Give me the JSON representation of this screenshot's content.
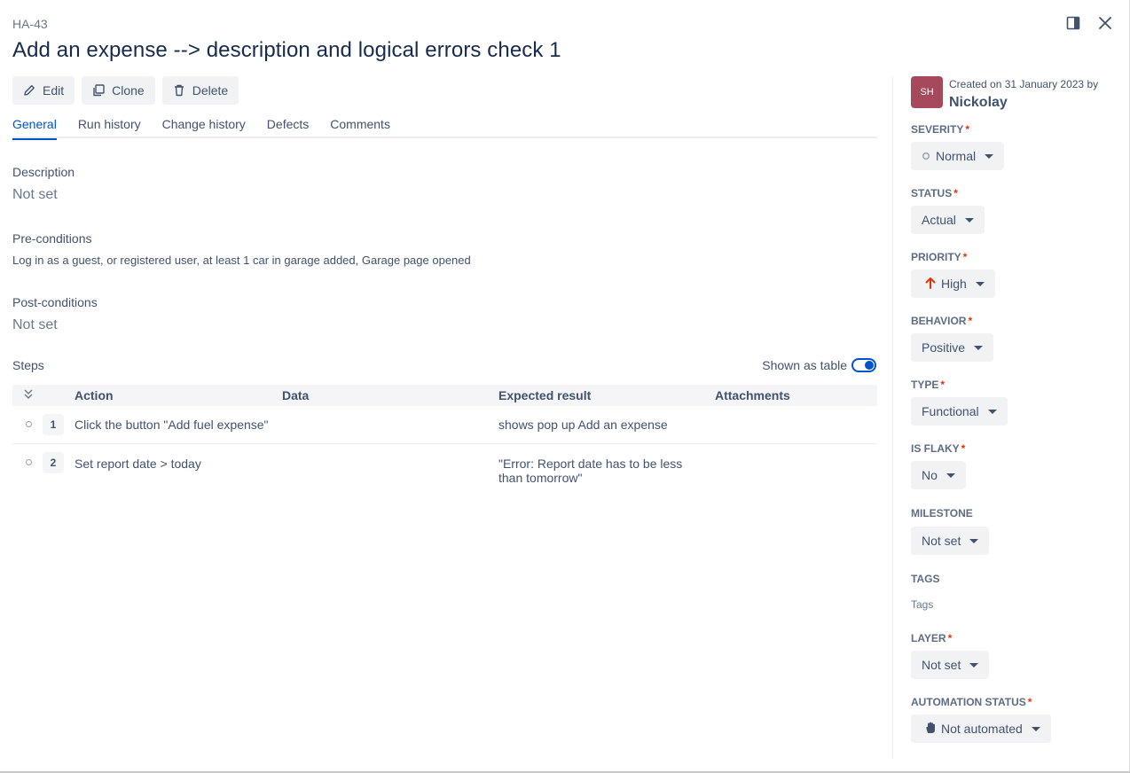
{
  "header": {
    "case_key": "HA-43",
    "title": "Add an expense --> description and logical errors check 1",
    "icons": [
      "panel-toggle-icon",
      "close-icon"
    ]
  },
  "toolbar": {
    "edit_label": "Edit",
    "clone_label": "Clone",
    "delete_label": "Delete"
  },
  "tabs": [
    {
      "label": "General",
      "active": true
    },
    {
      "label": "Run history",
      "active": false
    },
    {
      "label": "Change history",
      "active": false
    },
    {
      "label": "Defects",
      "active": false
    },
    {
      "label": "Comments",
      "active": false
    }
  ],
  "general": {
    "description_label": "Description",
    "description_value": "Not set",
    "preconditions_label": "Pre-conditions",
    "preconditions_value": "Log in as a guest, or registered user, at least 1 car in garage added, Garage page opened",
    "postconditions_label": "Post-conditions",
    "postconditions_value": "Not set"
  },
  "steps": {
    "label": "Steps",
    "shown_as_table_label": "Shown as table",
    "shown_as_table": true,
    "columns": [
      "Action",
      "Data",
      "Expected result",
      "Attachments"
    ],
    "rows": [
      {
        "number": "1",
        "action": "Click the button \"Add fuel expense\"",
        "data": "",
        "expected": "shows pop up Add an expense",
        "attachments": ""
      },
      {
        "number": "2",
        "action": "Set report date > today",
        "data": "",
        "expected_line1": "\"Error: Report date has to be less",
        "expected_line2": "than tomorrow\"",
        "attachments": ""
      }
    ]
  },
  "sidebar": {
    "avatar_initials": "SH",
    "avatar_color": "#a54a5c",
    "created_text": "Created on 31 January 2023 by",
    "creator": "Nickolay",
    "fields": {
      "severity": {
        "label": "SEVERITY",
        "value": "Normal",
        "required": true
      },
      "status": {
        "label": "STATUS",
        "value": "Actual",
        "required": true
      },
      "priority": {
        "label": "PRIORITY",
        "value": "High",
        "required": true,
        "icon": "arrow-up-icon",
        "icon_color": "#de350b"
      },
      "behavior": {
        "label": "BEHAVIOR",
        "value": "Positive",
        "required": true
      },
      "type": {
        "label": "TYPE",
        "value": "Functional",
        "required": true
      },
      "is_flaky": {
        "label": "IS FLAKY",
        "value": "No",
        "required": true
      },
      "milestone": {
        "label": "MILESTONE",
        "value": "Not set",
        "required": false
      },
      "tags": {
        "label": "TAGS",
        "value": "Tags",
        "required": false
      },
      "layer": {
        "label": "LAYER",
        "value": "Not set",
        "required": true
      },
      "automation_status": {
        "label": "AUTOMATION STATUS",
        "value": "Not automated",
        "required": true,
        "icon": "hand-icon"
      }
    }
  },
  "colors": {
    "accent": "#0052cc",
    "required_star": "#de350b"
  }
}
